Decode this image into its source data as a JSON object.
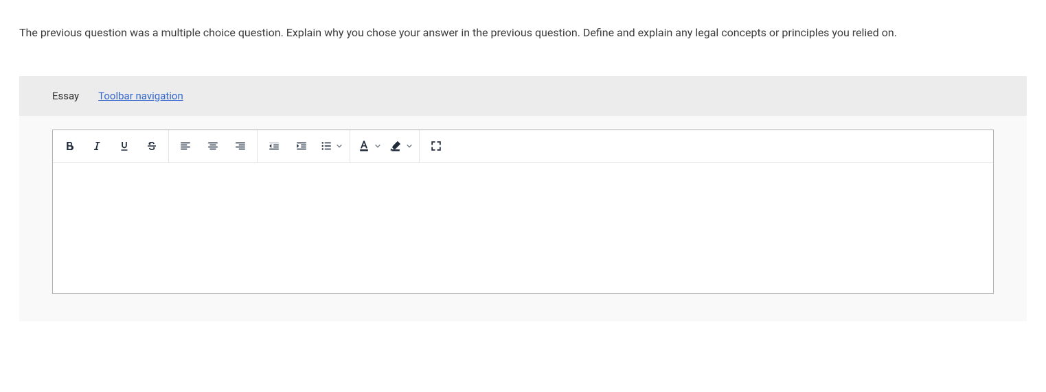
{
  "question": {
    "text": "The previous question was a multiple choice question. Explain why you chose your answer in the previous question. Define and explain any legal concepts or principles you relied on."
  },
  "editor": {
    "type_label": "Essay",
    "toolbar_nav_label": "Toolbar navigation ",
    "content": ""
  },
  "toolbar": {
    "bold": "Bold",
    "italic": "Italic",
    "underline": "Underline",
    "strike": "Strikethrough",
    "align_left": "Align left",
    "align_center": "Align center",
    "align_right": "Align right",
    "outdent": "Outdent",
    "indent": "Indent",
    "list": "List",
    "font_color": "Font color",
    "highlight": "Highlight color",
    "fullscreen": "Fullscreen"
  }
}
